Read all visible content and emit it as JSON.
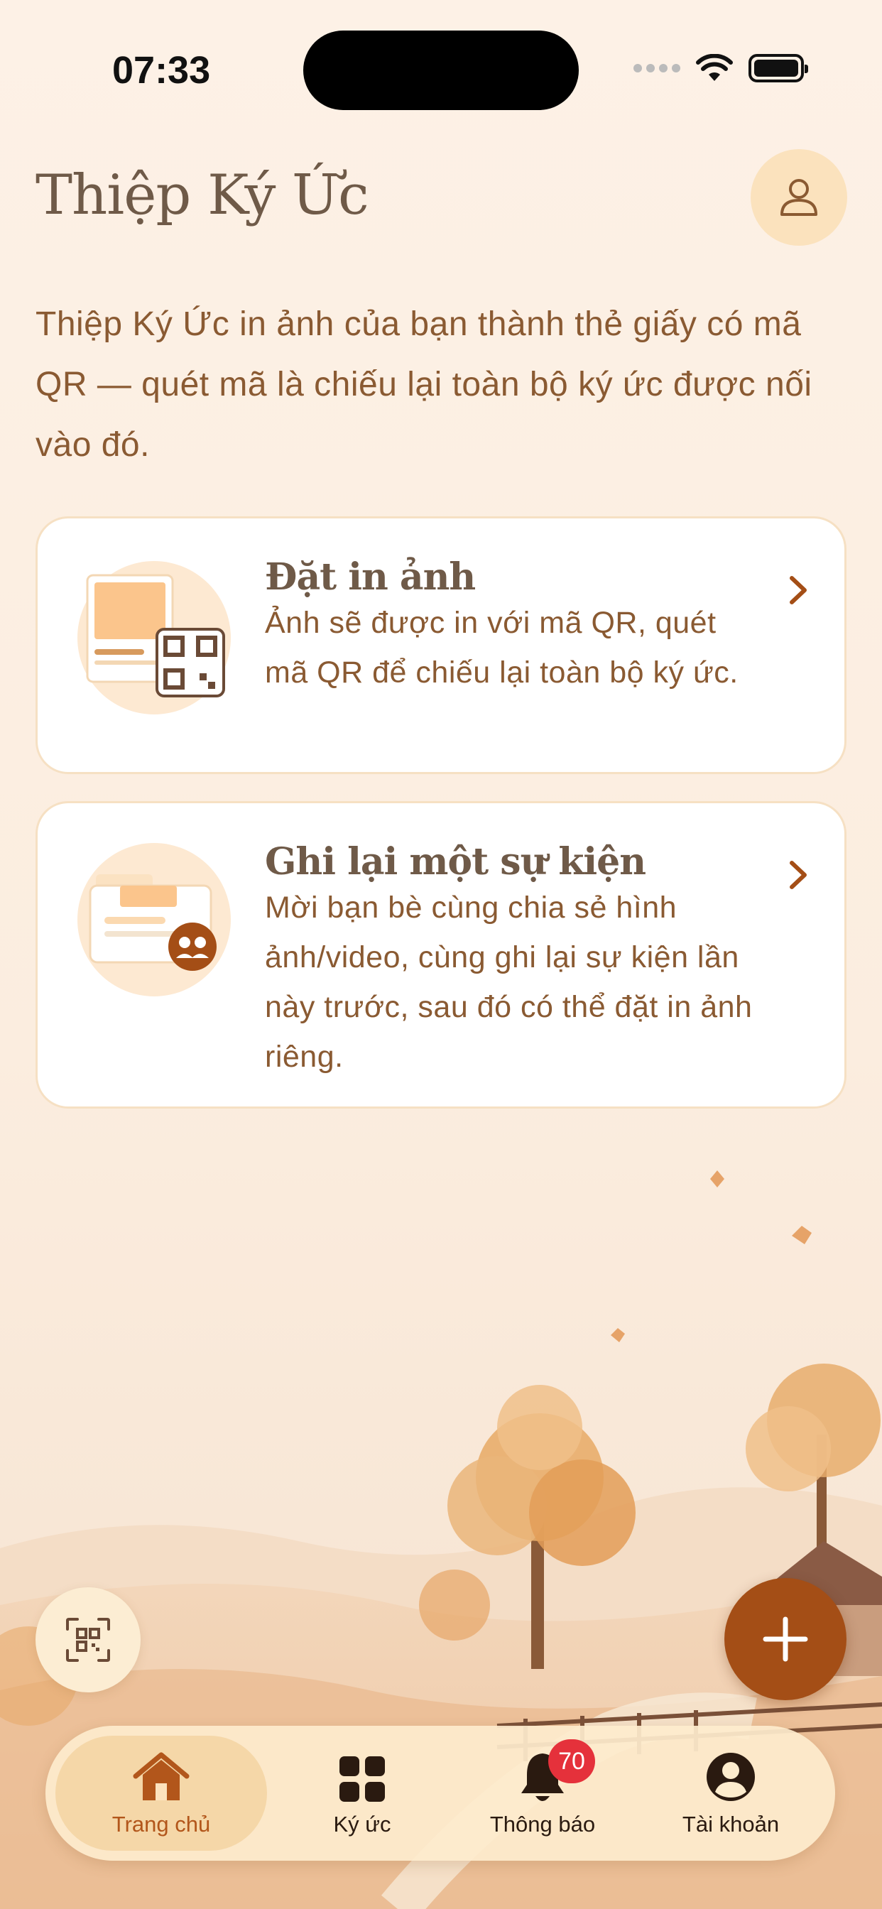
{
  "status_bar": {
    "time": "07:33"
  },
  "header": {
    "title": "Thiệp Ký Ức",
    "intro": "Thiệp Ký Ức in ảnh của bạn thành thẻ giấy có mã QR — quét mã là chiếu lại toàn bộ ký ức được nối vào đó."
  },
  "cards": [
    {
      "title": "Đặt in ảnh",
      "description": "Ảnh sẽ được in với mã QR, quét mã QR để chiếu lại toàn bộ ký ức."
    },
    {
      "title": "Ghi lại một sự kiện",
      "description": "Mời bạn bè cùng chia sẻ hình ảnh/video, cùng ghi lại sự kiện lần này trước, sau đó có thể đặt in ảnh riêng."
    }
  ],
  "tabbar": {
    "items": [
      {
        "label": "Trang chủ",
        "icon": "home-icon",
        "active": true
      },
      {
        "label": "Ký ức",
        "icon": "grid-icon"
      },
      {
        "label": "Thông báo",
        "icon": "bell-icon",
        "badge": "70"
      },
      {
        "label": "Tài khoản",
        "icon": "account-icon"
      }
    ]
  },
  "colors": {
    "accent": "#a44e16",
    "background": "#fcefe3",
    "badge": "#e5313b",
    "text": "#8a5a32"
  }
}
